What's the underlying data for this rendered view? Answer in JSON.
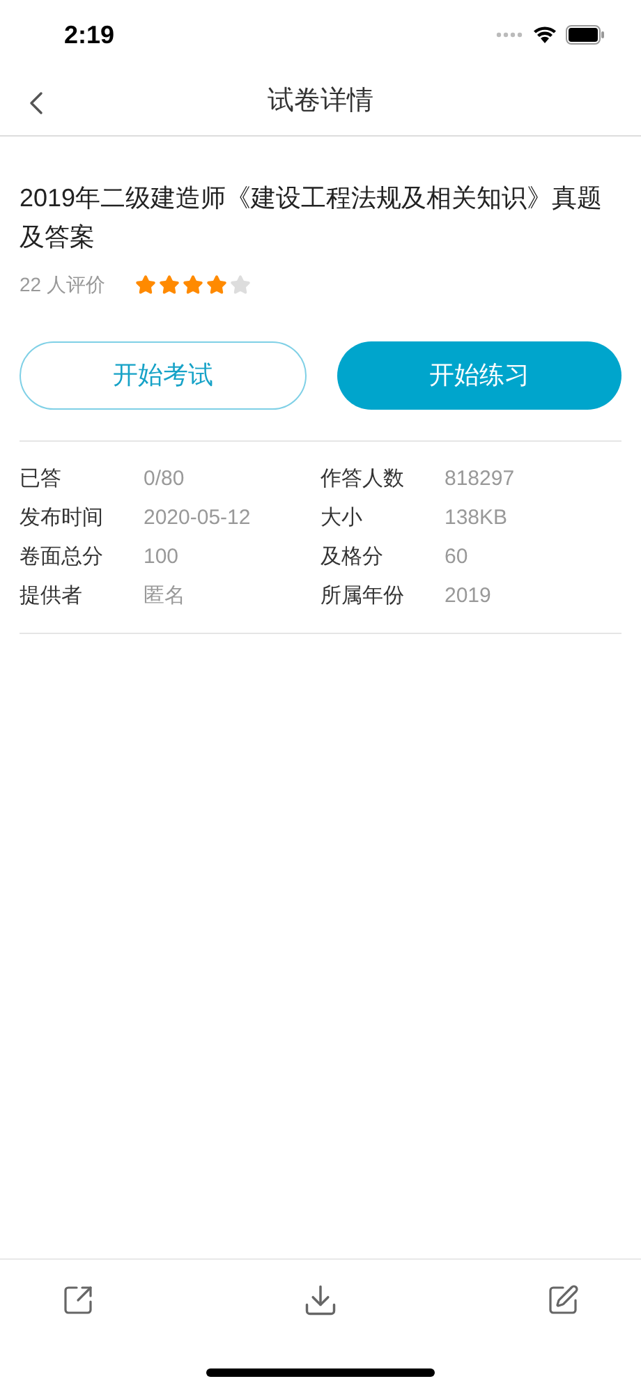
{
  "status_bar": {
    "time": "2:19"
  },
  "nav": {
    "title": "试卷详情"
  },
  "paper": {
    "title": "2019年二级建造师《建设工程法规及相关知识》真题及答案",
    "rating_count": "22 人评价",
    "stars": 4
  },
  "buttons": [
    {
      "label": "开始考试",
      "kind": "outline"
    },
    {
      "label": "开始练习",
      "kind": "filled"
    }
  ],
  "info": [
    {
      "label": "已答",
      "value": "0/80"
    },
    {
      "label": "作答人数",
      "value": "818297"
    },
    {
      "label": "发布时间",
      "value": "2020-05-12"
    },
    {
      "label": "大小",
      "value": "138KB"
    },
    {
      "label": "卷面总分",
      "value": "100"
    },
    {
      "label": "及格分",
      "value": "60"
    },
    {
      "label": "提供者",
      "value": "匿名"
    },
    {
      "label": "所属年份",
      "value": "2019"
    }
  ]
}
